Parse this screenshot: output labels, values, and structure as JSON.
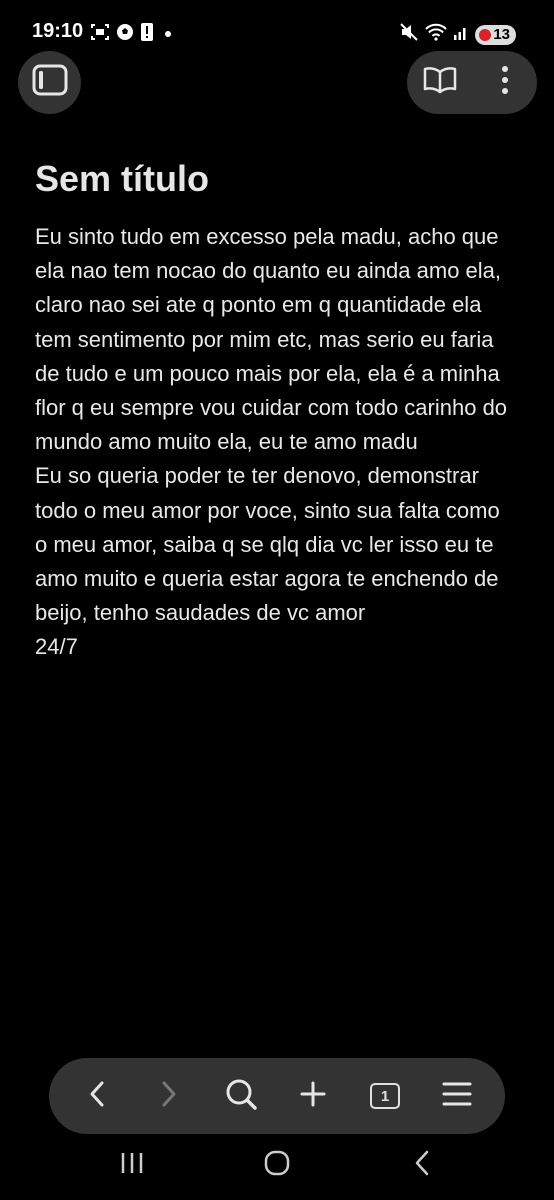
{
  "status_bar": {
    "time": "19:10",
    "battery": "13",
    "left_icons": [
      "screenshot-icon",
      "soccer-icon",
      "alert-icon",
      "dot-icon"
    ],
    "right_icons": [
      "mute-icon",
      "wifi-icon",
      "signal-icon",
      "battery-icon"
    ]
  },
  "toolbar_top": {
    "sidebar_icon": "sidebar-icon",
    "reader_icon": "book-icon",
    "menu_icon": "more-vertical-icon"
  },
  "note": {
    "title": "Sem título",
    "body": "Eu sinto tudo em excesso pela madu, acho que ela nao tem nocao do quanto eu ainda amo ela, claro nao sei ate q ponto em q quantidade ela tem sentimento por mim etc, mas serio eu faria de tudo e um pouco mais por ela, ela é a minha flor q eu sempre vou cuidar com todo carinho do mundo amo muito ela, eu te amo madu\nEu so queria poder te ter denovo, demonstrar todo o meu amor por voce, sinto sua falta como o meu amor, saiba q se qlq dia vc ler isso eu te amo muito e queria estar agora te enchendo de beijo, tenho saudades de vc amor\n24/7"
  },
  "bottom_toolbar": {
    "tab_count": "1",
    "icons": [
      "back-icon",
      "forward-icon",
      "search-icon",
      "add-icon",
      "tabs-icon",
      "menu-icon"
    ]
  },
  "nav_bar": {
    "icons": [
      "recents-icon",
      "home-icon",
      "nav-back-icon"
    ]
  },
  "colors": {
    "background": "#000000",
    "surface": "#333333",
    "text": "#e8e8e8",
    "battery_accent": "#d8232a"
  }
}
